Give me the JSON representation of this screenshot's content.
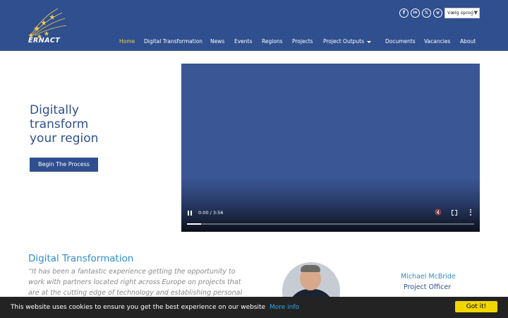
{
  "brand": {
    "logo_text": "ERNACT"
  },
  "social": [
    {
      "icon": "facebook-icon",
      "glyph": "f"
    },
    {
      "icon": "linkedin-icon",
      "glyph": "in"
    },
    {
      "icon": "x-twitter-icon",
      "glyph": "𝕏"
    },
    {
      "icon": "vimeo-icon",
      "glyph": "v"
    }
  ],
  "language": {
    "label": "Vælg sprog",
    "arrow": "▼"
  },
  "nav": {
    "items": [
      {
        "label": "Home",
        "active": true
      },
      {
        "label": "Digital Transformation"
      },
      {
        "label": "News"
      },
      {
        "label": "Events"
      },
      {
        "label": "Regions"
      },
      {
        "label": "Projects"
      },
      {
        "label": "Project Outputs"
      },
      {
        "label": "Documents"
      },
      {
        "label": "Vacancies"
      },
      {
        "label": "About"
      }
    ]
  },
  "hero": {
    "title_lines": [
      "Digitally",
      "transform",
      "your region"
    ],
    "cta_label": "Begin The Process"
  },
  "video": {
    "time": "0:00 / 3:56",
    "progress": 0.05,
    "mute_icon": "🔇"
  },
  "section": {
    "title": "Digital Transformation",
    "quote": "“It has been a fantastic experience getting the opportunity to work with partners located right across Europe on projects that are at the cutting edge of technology and establishing personal",
    "person_name": "Michael McBride",
    "person_role": "Project Officer"
  },
  "cookie": {
    "text": "This website uses cookies to ensure you get the best experience on our website",
    "link": "More info",
    "button": "Got it!"
  },
  "colors": {
    "header_bg": "#2f4f8f",
    "active_nav": "#f2c94c",
    "accent_blue": "#2f8fc9",
    "cookie_button": "#f1d600"
  }
}
